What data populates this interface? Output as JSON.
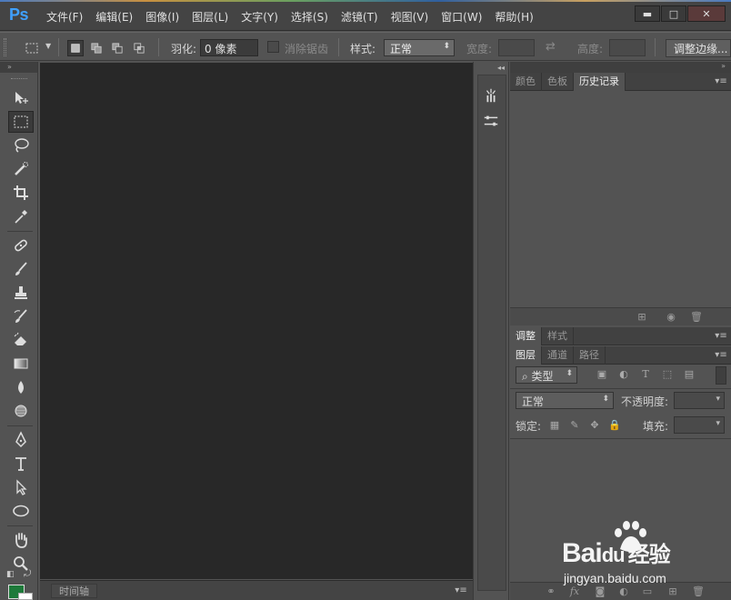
{
  "app": {
    "logo": "Ps"
  },
  "menu": [
    "文件(F)",
    "编辑(E)",
    "图像(I)",
    "图层(L)",
    "文字(Y)",
    "选择(S)",
    "滤镜(T)",
    "视图(V)",
    "窗口(W)",
    "帮助(H)"
  ],
  "window_controls": {
    "minimize": "▬",
    "maximize": "□",
    "close": "✕"
  },
  "options": {
    "feather_label": "羽化:",
    "feather_value": "0 像素",
    "antialias_label": "消除锯齿",
    "style_label": "样式:",
    "style_value": "正常",
    "width_label": "宽度:",
    "height_label": "高度:",
    "refine_edge": "调整边缘..."
  },
  "tools": [
    "move-tool-icon",
    "marquee-tool-icon",
    "lasso-tool-icon",
    "quick-select-tool-icon",
    "crop-tool-icon",
    "eyedropper-tool-icon",
    "healing-brush-tool-icon",
    "brush-tool-icon",
    "clone-stamp-tool-icon",
    "history-brush-tool-icon",
    "eraser-tool-icon",
    "gradient-tool-icon",
    "blur-tool-icon",
    "dodge-tool-icon",
    "pen-tool-icon",
    "type-tool-icon",
    "path-select-tool-icon",
    "ellipse-tool-icon",
    "hand-tool-icon",
    "zoom-tool-icon"
  ],
  "colors": {
    "foreground": "#1e7a3a",
    "background": "#ffffff",
    "accent": "#3fa0ff"
  },
  "timeline": {
    "label": "时间轴"
  },
  "panels": {
    "top_tabs": [
      "颜色",
      "色板",
      "历史记录"
    ],
    "top_active": 2,
    "adjust_tabs": [
      "调整",
      "样式"
    ],
    "layer_tabs": [
      "图层",
      "通道",
      "路径"
    ],
    "layer_filter_value": "类型",
    "blend_mode": "正常",
    "opacity_label": "不透明度:",
    "lock_label": "锁定:",
    "fill_label": "填充:"
  },
  "watermark": {
    "main": "Bai",
    "paw": "du",
    "cn": "经验",
    "sub": "jingyan.baidu.com"
  }
}
